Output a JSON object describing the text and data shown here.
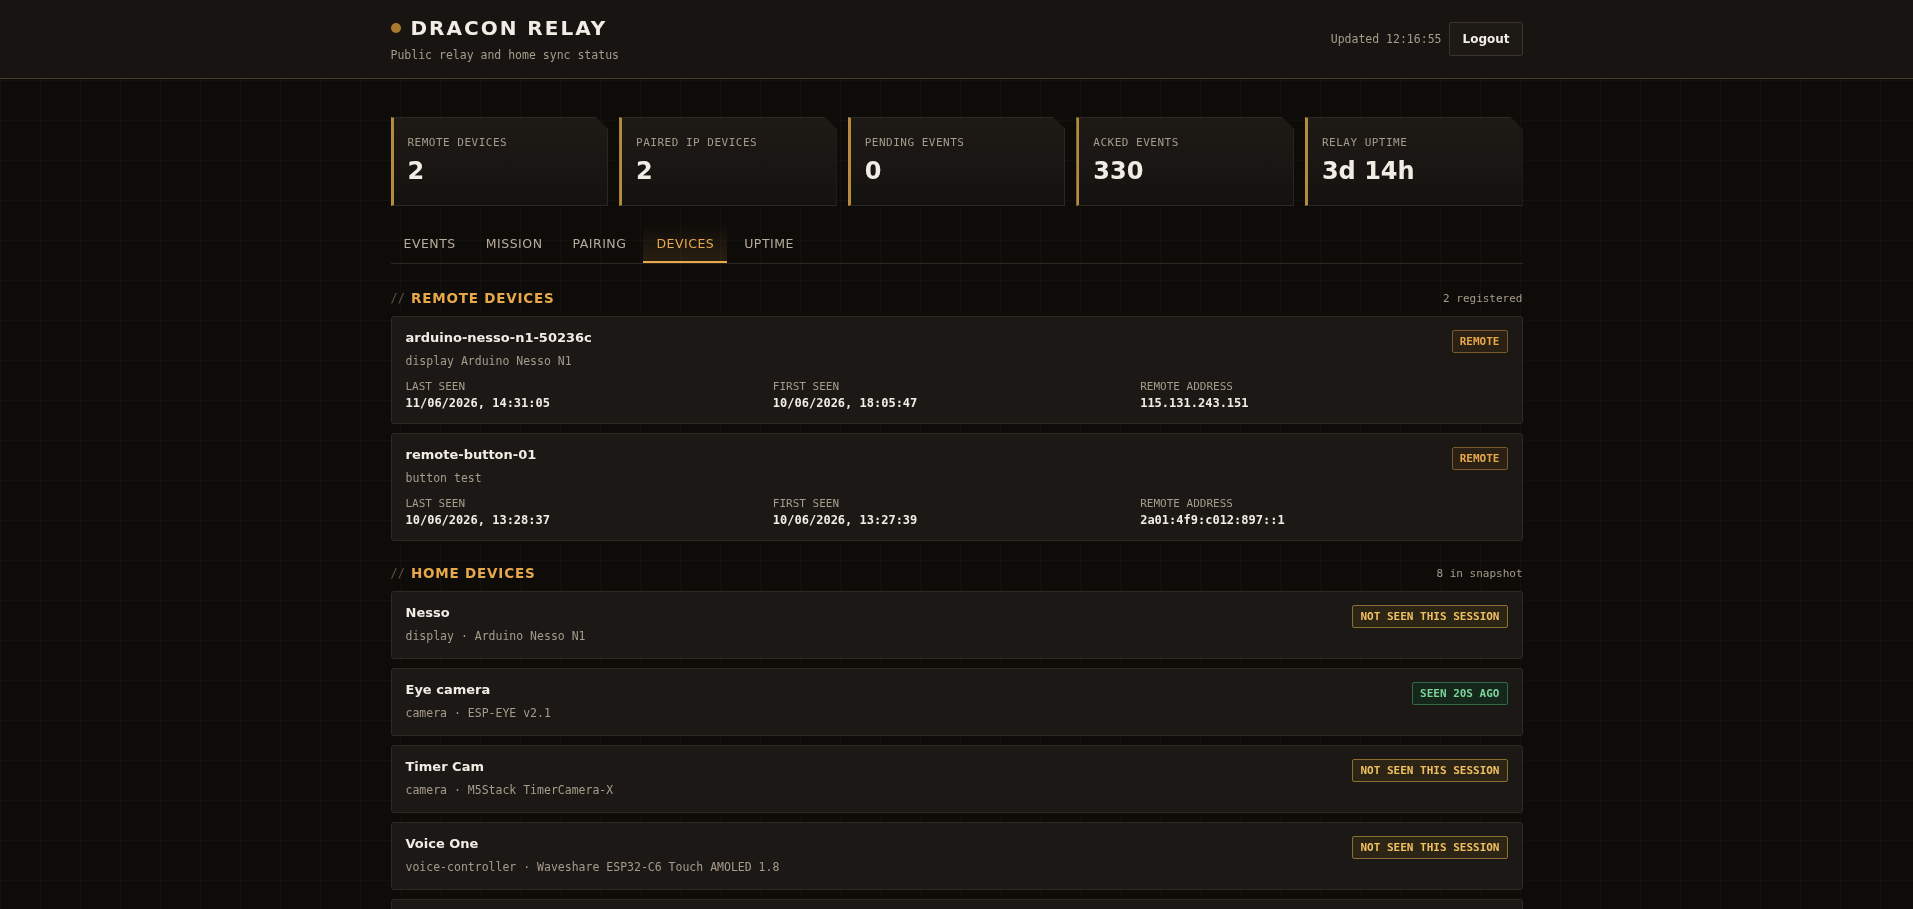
{
  "header": {
    "title": "DRACON RELAY",
    "subtitle": "Public relay and home sync status",
    "updated": "Updated 12:16:55",
    "logout": "Logout"
  },
  "stats": [
    {
      "label": "REMOTE DEVICES",
      "value": "2"
    },
    {
      "label": "PAIRED IP DEVICES",
      "value": "2"
    },
    {
      "label": "PENDING EVENTS",
      "value": "0"
    },
    {
      "label": "ACKED EVENTS",
      "value": "330"
    },
    {
      "label": "RELAY UPTIME",
      "value": "3d 14h"
    }
  ],
  "tabs": [
    {
      "label": "EVENTS",
      "selected": false
    },
    {
      "label": "MISSION",
      "selected": false
    },
    {
      "label": "PAIRING",
      "selected": false
    },
    {
      "label": "DEVICES",
      "selected": true
    },
    {
      "label": "UPTIME",
      "selected": false
    }
  ],
  "remote_section": {
    "marker": "//",
    "title": "REMOTE DEVICES",
    "count": "2 registered",
    "devices": [
      {
        "name": "arduino-nesso-n1-50236c",
        "description": "display Arduino Nesso N1",
        "badge": "REMOTE",
        "fields": [
          {
            "label": "LAST SEEN",
            "value": "11/06/2026, 14:31:05"
          },
          {
            "label": "FIRST SEEN",
            "value": "10/06/2026, 18:05:47"
          },
          {
            "label": "REMOTE ADDRESS",
            "value": "115.131.243.151"
          }
        ]
      },
      {
        "name": "remote-button-01",
        "description": "button test",
        "badge": "REMOTE",
        "fields": [
          {
            "label": "LAST SEEN",
            "value": "10/06/2026, 13:28:37"
          },
          {
            "label": "FIRST SEEN",
            "value": "10/06/2026, 13:27:39"
          },
          {
            "label": "REMOTE ADDRESS",
            "value": "2a01:4f9:c012:897::1"
          }
        ]
      }
    ]
  },
  "home_section": {
    "marker": "//",
    "title": "HOME DEVICES",
    "count": "8 in snapshot",
    "devices": [
      {
        "name": "Nesso",
        "description": "display · Arduino Nesso N1",
        "status": {
          "label": "NOT SEEN THIS SESSION",
          "kind": "stale"
        }
      },
      {
        "name": "Eye camera",
        "description": "camera · ESP-EYE v2.1",
        "status": {
          "label": "SEEN 20S AGO",
          "kind": "recent"
        }
      },
      {
        "name": "Timer Cam",
        "description": "camera · M5Stack TimerCamera-X",
        "status": {
          "label": "NOT SEEN THIS SESSION",
          "kind": "stale"
        }
      },
      {
        "name": "Voice One",
        "description": "voice-controller · Waveshare ESP32-C6 Touch AMOLED 1.8",
        "status": {
          "label": "NOT SEEN THIS SESSION",
          "kind": "stale"
        }
      }
    ]
  }
}
